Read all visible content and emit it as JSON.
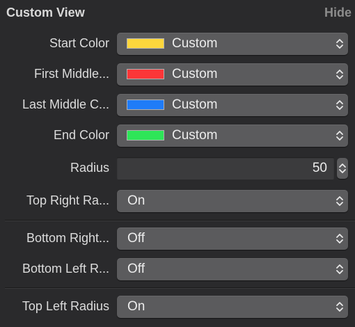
{
  "header": {
    "title": "Custom View",
    "hide_label": "Hide"
  },
  "rows": [
    {
      "label": "Start Color",
      "value": "Custom",
      "swatch_color": "#fcd63c"
    },
    {
      "label": "First Middle...",
      "value": "Custom",
      "swatch_color": "#fb3638"
    },
    {
      "label": "Last Middle C...",
      "value": "Custom",
      "swatch_color": "#1f7cf8"
    },
    {
      "label": "End Color",
      "value": "Custom",
      "swatch_color": "#2ee558"
    },
    {
      "label": "Radius",
      "value": "50"
    },
    {
      "label": "Top Right Ra...",
      "value": "On"
    },
    {
      "label": "Bottom Right...",
      "value": "Off"
    },
    {
      "label": "Bottom Left R...",
      "value": "Off"
    },
    {
      "label": "Top Left Radius",
      "value": "On"
    }
  ],
  "icons": {
    "chevron": "up-down-chevron-icon",
    "stepper": "stepper-icon"
  }
}
